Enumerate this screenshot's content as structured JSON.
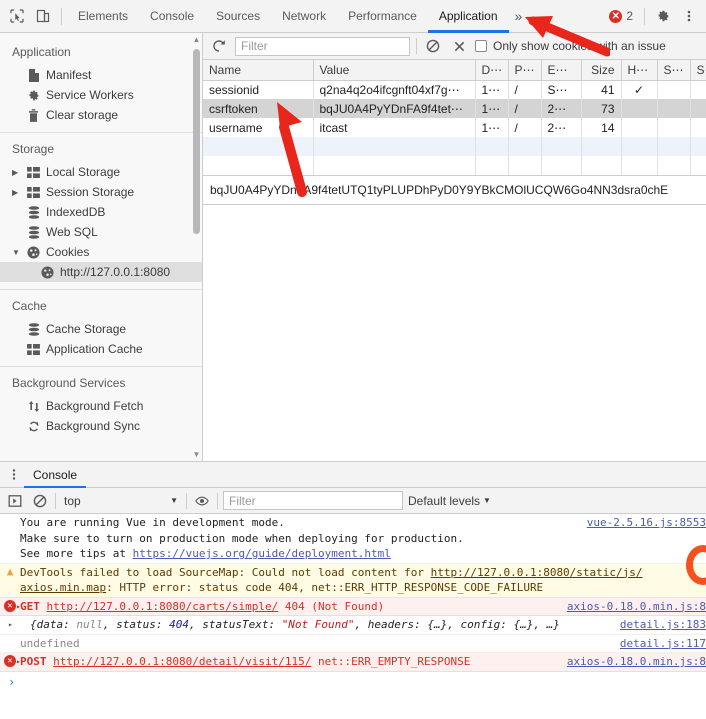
{
  "toolbar": {
    "inspect_icon": "cursor-select-icon",
    "device_icon": "device-toggle-icon",
    "tabs": [
      {
        "label": "Elements",
        "active": false
      },
      {
        "label": "Console",
        "active": false
      },
      {
        "label": "Sources",
        "active": false
      },
      {
        "label": "Network",
        "active": false
      },
      {
        "label": "Performance",
        "active": false
      },
      {
        "label": "Application",
        "active": true
      }
    ],
    "more_label": "»",
    "error_count": "2",
    "error_badge_glyph": "✕",
    "settings_icon": "gear-icon",
    "menu_icon": "kebab-menu-icon"
  },
  "sidebar": {
    "groups": [
      {
        "title": "Application",
        "items": [
          {
            "label": "Manifest",
            "icon": "document-icon",
            "expandable": false,
            "selected": false,
            "indent": 1
          },
          {
            "label": "Service Workers",
            "icon": "gear-icon",
            "expandable": false,
            "selected": false,
            "indent": 1
          },
          {
            "label": "Clear storage",
            "icon": "trash-icon",
            "expandable": false,
            "selected": false,
            "indent": 1
          }
        ]
      },
      {
        "title": "Storage",
        "items": [
          {
            "label": "Local Storage",
            "icon": "table-icon",
            "expandable": true,
            "expanded": false,
            "selected": false,
            "indent": 1
          },
          {
            "label": "Session Storage",
            "icon": "table-icon",
            "expandable": true,
            "expanded": false,
            "selected": false,
            "indent": 1
          },
          {
            "label": "IndexedDB",
            "icon": "database-icon",
            "expandable": false,
            "selected": false,
            "indent": 1
          },
          {
            "label": "Web SQL",
            "icon": "database-icon",
            "expandable": false,
            "selected": false,
            "indent": 1
          },
          {
            "label": "Cookies",
            "icon": "cookie-icon",
            "expandable": true,
            "expanded": true,
            "selected": false,
            "indent": 1
          },
          {
            "label": "http://127.0.0.1:8080",
            "icon": "cookie-icon",
            "expandable": false,
            "selected": true,
            "indent": 2
          }
        ]
      },
      {
        "title": "Cache",
        "items": [
          {
            "label": "Cache Storage",
            "icon": "database-icon",
            "expandable": false,
            "selected": false,
            "indent": 1
          },
          {
            "label": "Application Cache",
            "icon": "table-icon",
            "expandable": false,
            "selected": false,
            "indent": 1
          }
        ]
      },
      {
        "title": "Background Services",
        "items": [
          {
            "label": "Background Fetch",
            "icon": "updown-arrow-icon",
            "expandable": false,
            "selected": false,
            "indent": 1
          },
          {
            "label": "Background Sync",
            "icon": "sync-icon",
            "expandable": false,
            "selected": false,
            "indent": 1
          }
        ]
      }
    ]
  },
  "cookies_panel": {
    "refresh_icon": "refresh-icon",
    "filter_placeholder": "Filter",
    "clear_all_icon": "block-clear-icon",
    "delete_icon": "close-x-icon",
    "issue_checkbox_label": "Only show cookies with an issue",
    "issue_checkbox_checked": false,
    "columns": [
      {
        "key": "name",
        "label": "Name"
      },
      {
        "key": "value",
        "label": "Value"
      },
      {
        "key": "domain",
        "label": "D⋯"
      },
      {
        "key": "path",
        "label": "P⋯"
      },
      {
        "key": "expires",
        "label": "E⋯"
      },
      {
        "key": "size",
        "label": "Size"
      },
      {
        "key": "httponly",
        "label": "H⋯"
      },
      {
        "key": "secure",
        "label": "S⋯"
      },
      {
        "key": "samesite",
        "label": "S⋯"
      }
    ],
    "rows": [
      {
        "name": "sessionid",
        "value": "q2na4q2o4ifcgnft04xf7g⋯",
        "domain": "1⋯",
        "path": "/",
        "expires": "S⋯",
        "size": "41",
        "httponly": "✓",
        "secure": "",
        "samesite": "",
        "selected": false
      },
      {
        "name": "csrftoken",
        "value": "bqJU0A4PyYDnFA9f4tet⋯",
        "domain": "1⋯",
        "path": "/",
        "expires": "2⋯",
        "size": "73",
        "httponly": "",
        "secure": "",
        "samesite": "",
        "selected": true
      },
      {
        "name": "username",
        "value": "itcast",
        "domain": "1⋯",
        "path": "/",
        "expires": "2⋯",
        "size": "14",
        "httponly": "",
        "secure": "",
        "samesite": "",
        "selected": false
      }
    ],
    "selected_value_detail": "bqJU0A4PyYDnFA9f4tetUTQ1tyPLUPDhPyD0Y9YBkCMOlUCQW6Go4NN3dsra0chE"
  },
  "console_drawer": {
    "kebab_icon": "kebab-menu-icon",
    "tab_label": "Console",
    "execute_icon": "execute-sidebar-icon",
    "clear_icon": "block-clear-icon",
    "context": "top",
    "context_caret": "▼",
    "eye_icon": "eye-live-expression-icon",
    "filter_placeholder": "Filter",
    "levels_label": "Default levels",
    "levels_caret": "▼",
    "messages": [
      {
        "type": "plain",
        "source": "vue-2.5.16.js:8553",
        "lines": [
          {
            "text": "You are running Vue in development mode."
          },
          {
            "text": "Make sure to turn on production mode when deploying for production."
          },
          {
            "text": "See more tips at ",
            "link": "https://vuejs.org/guide/deployment.html"
          }
        ]
      },
      {
        "type": "warn",
        "source": "",
        "icon": "warning-triangle-icon",
        "lines": [
          {
            "text": "DevTools failed to load SourceMap: Could not load content for ",
            "link": "http://127.0.0.1:8080/static/js/"
          },
          {
            "link": "axios.min.map",
            "text": ": HTTP error: status code 404, net::ERR_HTTP_RESPONSE_CODE_FAILURE"
          }
        ]
      },
      {
        "type": "error",
        "icon": "error-circle-icon",
        "disclosure": "▸",
        "method": "GET",
        "url": "http://127.0.0.1:8080/carts/simple/",
        "status": "404 (Not Found)",
        "source": "axios-0.18.0.min.js:8"
      },
      {
        "type": "object",
        "disclosure": "▸",
        "source": "detail.js:183",
        "prefix": "{data: ",
        "null_val": "null",
        "mid1": ", status: ",
        "status_val": "404",
        "mid2": ", statusText: ",
        "status_text": "\"Not Found\"",
        "suffix": ", headers: {…}, config: {…}, …}"
      },
      {
        "type": "plain",
        "text": "undefined",
        "source": "detail.js:117"
      },
      {
        "type": "error",
        "icon": "error-circle-icon",
        "disclosure": "▸",
        "method": "POST",
        "url": "http://127.0.0.1:8080/detail/visit/115/",
        "status": "net::ERR_EMPTY_RESPONSE",
        "source": "axios-0.18.0.min.js:8"
      }
    ],
    "prompt": "›"
  },
  "annotations": {
    "arrow_color": "#e8261c",
    "circle_color": "#f4511e",
    "arrows": [
      {
        "name": "arrow-pointing-application-tab"
      },
      {
        "name": "arrow-pointing-csrftoken-row"
      }
    ]
  }
}
